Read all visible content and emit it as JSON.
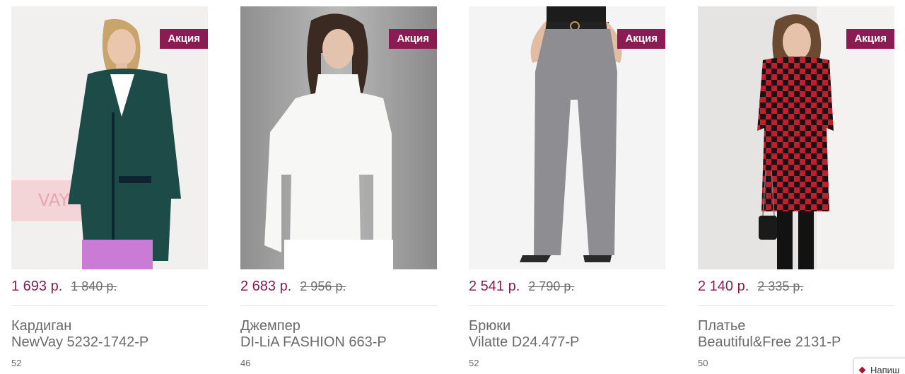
{
  "products": [
    {
      "badge": "Акция",
      "price_new": "1 693 р.",
      "price_old": "1 840 р.",
      "title_line1": "Кардиган",
      "title_line2": "NewVay 5232-1742-Р",
      "size": "52",
      "image_icon": "cardigan-photo"
    },
    {
      "badge": "Акция",
      "price_new": "2 683 р.",
      "price_old": "2 956 р.",
      "title_line1": "Джемпер",
      "title_line2": "DI-LiA FASHION 663-Р",
      "size": "46",
      "image_icon": "sweater-photo"
    },
    {
      "badge": "Акция",
      "price_new": "2 541 р.",
      "price_old": "2 790 р.",
      "title_line1": "Брюки",
      "title_line2": "Vilatte D24.477-Р",
      "size": "52",
      "image_icon": "trousers-photo"
    },
    {
      "badge": "Акция",
      "price_new": "2 140 р.",
      "price_old": "2 335 р.",
      "title_line1": "Платье",
      "title_line2": "Beautiful&Free 2131-Р",
      "size": "50",
      "image_icon": "dress-photo"
    }
  ],
  "help_widget": {
    "label": "Напиш"
  },
  "colors": {
    "accent": "#8a1c53",
    "text": "#6a6a6a",
    "divider": "#e4e4e4"
  }
}
